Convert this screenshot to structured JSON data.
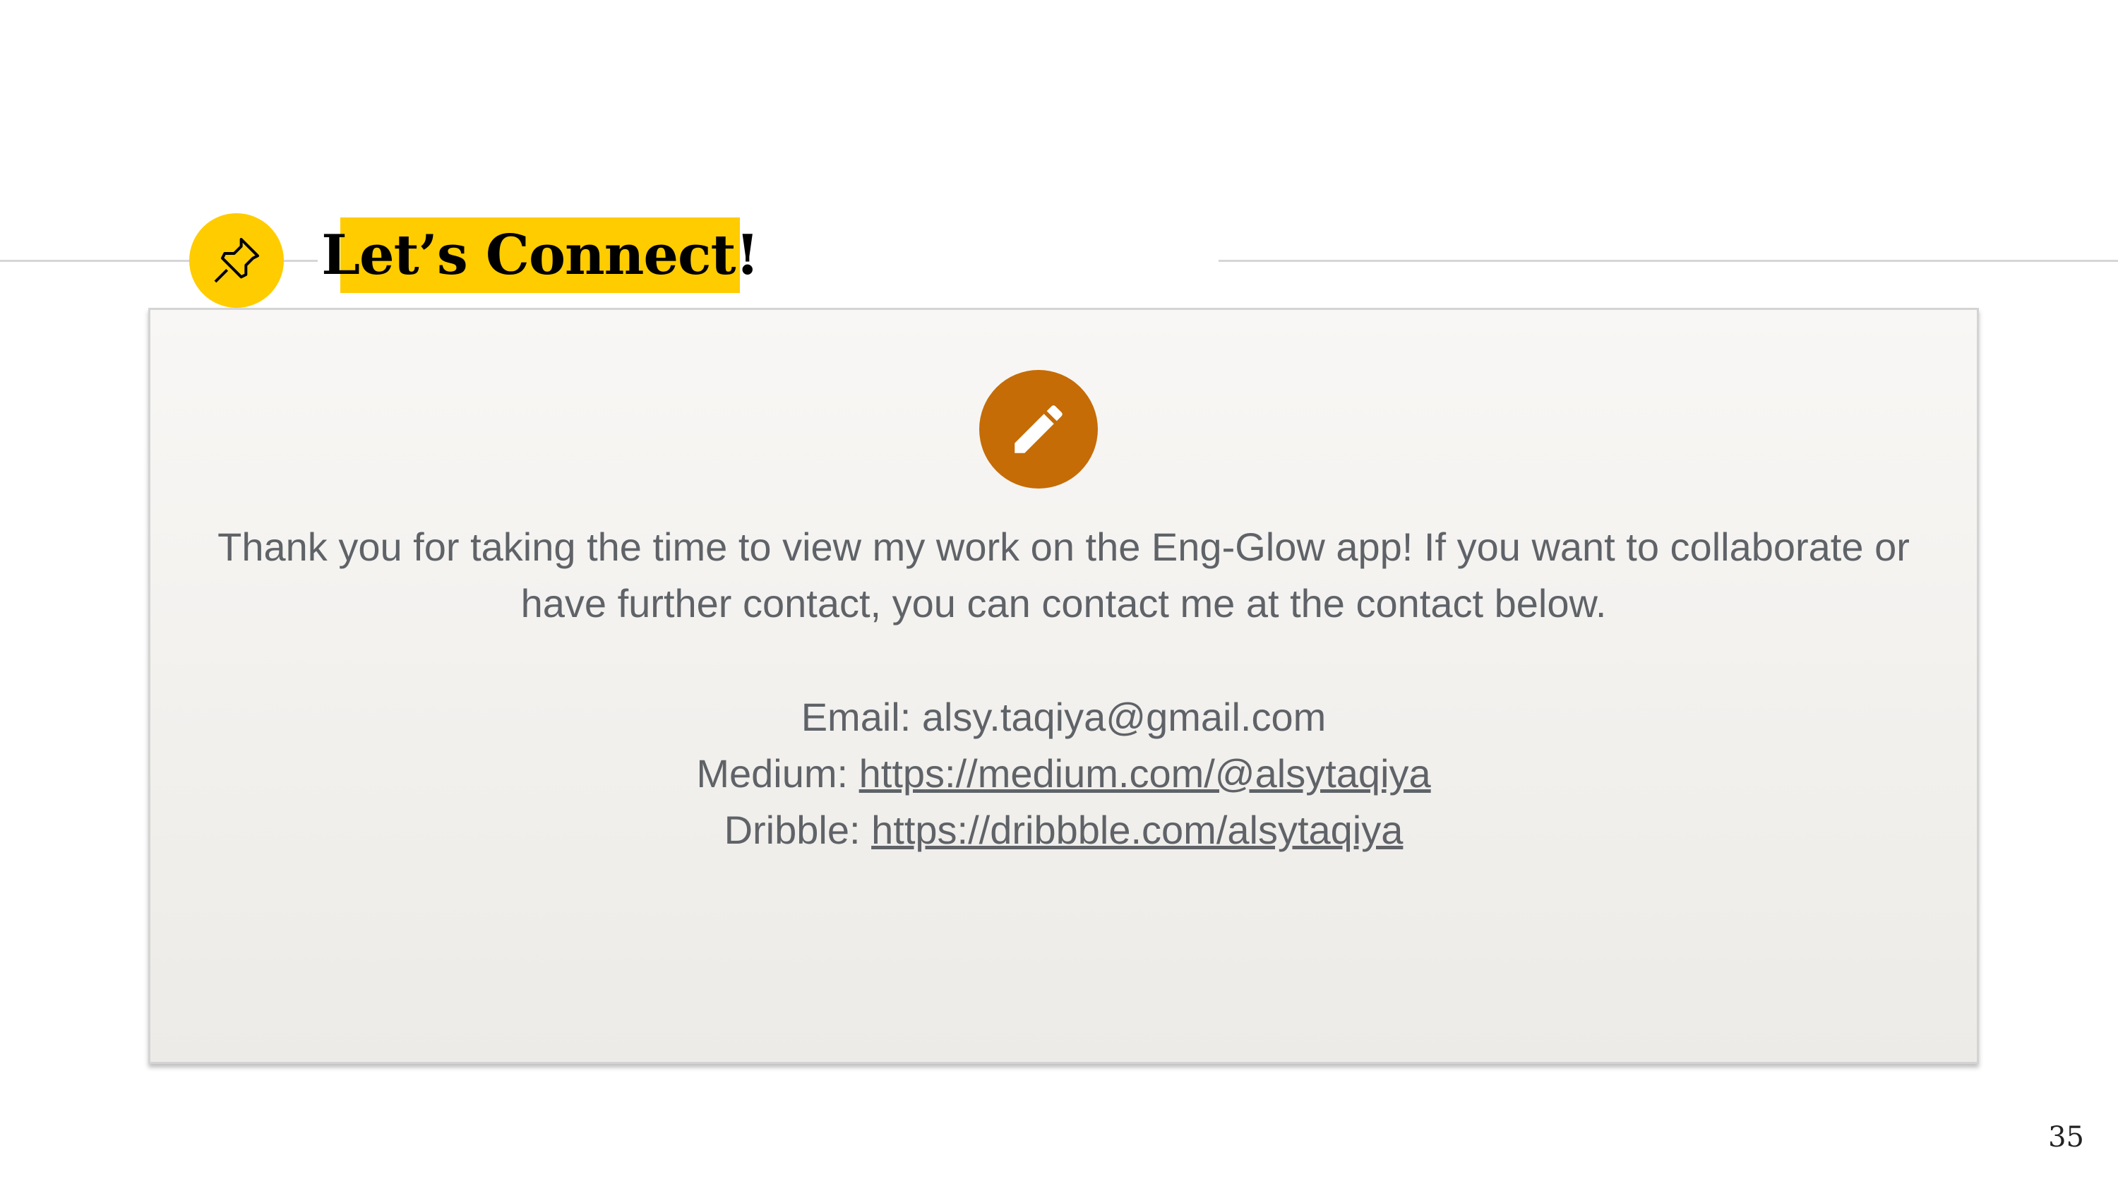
{
  "slide": {
    "title": "Let’s Connect!",
    "intro_line1": "Thank you for taking the time to view my work on the Eng-Glow app! If you want to collaborate or",
    "intro_line2": "have further contact, you can contact me at the contact below.",
    "contacts": [
      {
        "label": "Email: ",
        "value": "alsy.taqiya@gmail.com"
      },
      {
        "label": "Medium: ",
        "value": "https://medium.com/@alsytaqiya"
      },
      {
        "label": "Dribble: ",
        "value": "https://dribbble.com/alsytaqiya"
      }
    ],
    "page_number": "35"
  },
  "icons": {
    "header": "pushpin-icon",
    "card": "pencil-icon"
  },
  "colors": {
    "accent_yellow": "#ffcc00",
    "pencil_circle": "#c56c07",
    "body_text": "#5f6368"
  }
}
